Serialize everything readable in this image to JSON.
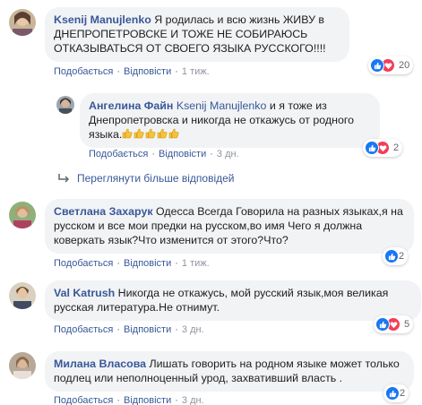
{
  "comments": [
    {
      "author": "Ksenij Manujlenko",
      "text": "Я родилась и всю жизнь ЖИВУ в ДНЕПРОПЕТРОВСКЕ И ТОЖЕ НЕ СОБИРАЮСЬ ОТКАЗЫВАТЬСЯ ОТ СВОЕГО ЯЗЫКА РУССКОГО!!!!",
      "like": "Подобається",
      "reply": "Відповісти",
      "time": "1 тиж.",
      "reaction_count": "20",
      "reply_item": {
        "author": "Ангелина Файн",
        "mention": "Ksenij Manujlenko",
        "text": "и я тоже из Днепропетровска и никогда не откажусь от родного языка.",
        "emoji_name": "thumbs-up-emoji",
        "like": "Подобається",
        "reply": "Відповісти",
        "time": "3 дн.",
        "reaction_count": "2"
      },
      "more_replies": "Переглянути більше відповідей"
    },
    {
      "author": "Светлана Захарук",
      "text": "Одесса Всегда Говорила на разных языках,я на русском и все мои предки на русском,во имя Чего я должна коверкать язык?Что изменится от этого?Что?",
      "like": "Подобається",
      "reply": "Відповісти",
      "time": "1 тиж.",
      "reaction_count": "2"
    },
    {
      "author": "Val Katrush",
      "text": "Никогда не откажусь, мой русский язык,моя великая русская литература.Не отнимут.",
      "like": "Подобається",
      "reply": "Відповісти",
      "time": "3 дн.",
      "reaction_count": "5"
    },
    {
      "author": "Милана Власова",
      "text": "Лишать говорить на родном языке может только подлец или неполноценный урод, захвативший власть .",
      "like": "Подобається",
      "reply": "Відповісти",
      "time": "3 дн.",
      "reaction_count": "2"
    }
  ],
  "colors": {
    "link": "#385898",
    "bubble": "#f2f3f5",
    "like": "#1877f2",
    "love": "#f33e58",
    "meta": "#606770"
  }
}
